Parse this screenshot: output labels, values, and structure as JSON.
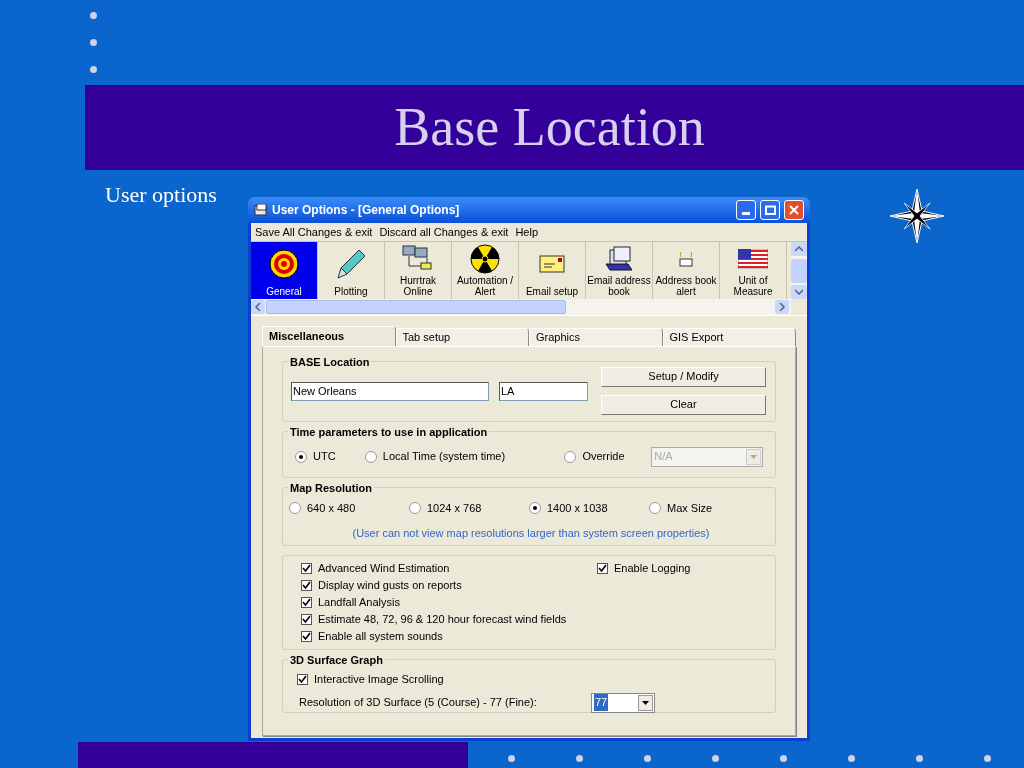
{
  "slide": {
    "title": "Base Location",
    "subtitle": "User options"
  },
  "window": {
    "title": "User Options - [General Options]"
  },
  "menu": [
    "Save All Changes & exit",
    "Discard all Changes & exit",
    "Help"
  ],
  "toolbar": [
    {
      "label": "General",
      "kind": "target",
      "selected": true
    },
    {
      "label": "Plotting",
      "kind": "pen",
      "selected": false
    },
    {
      "label": "Hurrtrak Online",
      "kind": "network",
      "selected": false
    },
    {
      "label": "Automation / Alert",
      "kind": "radiation",
      "selected": false
    },
    {
      "label": "Email setup",
      "kind": "envelope",
      "selected": false
    },
    {
      "label": "Email address book",
      "kind": "cards",
      "selected": false
    },
    {
      "label": "Address book alert",
      "kind": "alert",
      "selected": false
    },
    {
      "label": "Unit of Measure",
      "kind": "flag",
      "selected": false
    }
  ],
  "tabs": [
    {
      "label": "Miscellaneous",
      "selected": true
    },
    {
      "label": "Tab setup",
      "selected": false
    },
    {
      "label": "Graphics",
      "selected": false
    },
    {
      "label": "GIS Export",
      "selected": false
    }
  ],
  "base_location": {
    "title": "BASE Location",
    "city": "New Orleans",
    "state": "LA",
    "buttons": [
      "Setup / Modify",
      "Clear"
    ]
  },
  "time_parameters": {
    "title": "Time parameters to use in application",
    "options": [
      {
        "label": "UTC",
        "selected": true
      },
      {
        "label": "Local Time (system time)",
        "selected": false
      },
      {
        "label": "Override",
        "selected": false
      }
    ],
    "override_value": "N/A",
    "override_disabled": true
  },
  "map_resolution": {
    "title": "Map Resolution",
    "options": [
      {
        "label": "640 x 480",
        "selected": false
      },
      {
        "label": "1024 x 768",
        "selected": false
      },
      {
        "label": "1400 x 1038",
        "selected": true
      },
      {
        "label": "Max Size",
        "selected": false
      }
    ],
    "note": "(User can not view map resolutions larger than system screen properties)"
  },
  "options": {
    "left": [
      {
        "label": "Advanced Wind Estimation",
        "checked": true
      },
      {
        "label": "Display wind gusts on reports",
        "checked": true
      },
      {
        "label": "Landfall Analysis",
        "checked": true
      },
      {
        "label": "Estimate 48, 72, 96 & 120 hour forecast wind fields",
        "checked": true
      },
      {
        "label": "Enable all system sounds",
        "checked": true
      }
    ],
    "right": [
      {
        "label": "Enable Logging",
        "checked": true
      }
    ]
  },
  "surface_graph": {
    "title": "3D Surface Graph",
    "scrolling": {
      "label": "Interactive Image Scrolling",
      "checked": true
    },
    "resolution": {
      "label": "Resolution of 3D Surface (5 (Course) - 77 (Fine):",
      "value": "77"
    }
  }
}
